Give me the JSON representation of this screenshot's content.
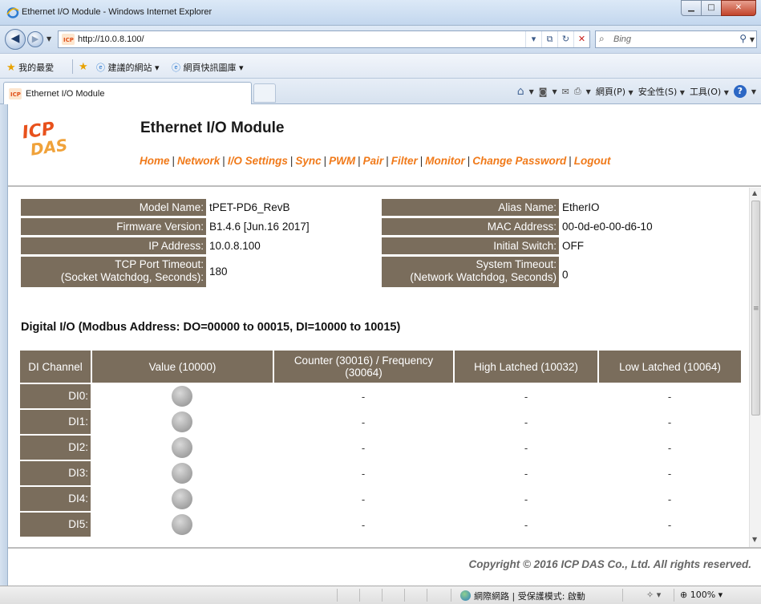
{
  "window": {
    "title": "Ethernet I/O Module - Windows Internet Explorer",
    "min_glyph": "▁",
    "max_glyph": "□",
    "close_glyph": "✕"
  },
  "address_bar": {
    "url": "http://10.0.8.100/",
    "search_placeholder": "Bing"
  },
  "favorites_bar": {
    "favorites_label": "我的最愛",
    "suggested_sites": "建議的網站 ▾",
    "web_slice_gallery": "網頁快訊圖庫 ▾"
  },
  "tab": {
    "label": "Ethernet I/O Module"
  },
  "command_bar": {
    "page": "網頁(P)",
    "safety": "安全性(S)",
    "tools": "工具(O)",
    "help": "?"
  },
  "header": {
    "logo_text": "ICP DAS",
    "title": "Ethernet I/O Module",
    "nav": [
      "Home",
      "Network",
      "I/O Settings",
      "Sync",
      "PWM",
      "Pair",
      "Filter",
      "Monitor",
      "Change Password",
      "Logout"
    ]
  },
  "info": {
    "left": [
      {
        "label": "Model Name:",
        "value": "tPET-PD6_RevB"
      },
      {
        "label": "Firmware Version:",
        "value": "B1.4.6 [Jun.16 2017]"
      },
      {
        "label": "IP Address:",
        "value": "10.0.8.100"
      },
      {
        "label_line1": "TCP Port Timeout:",
        "label_line2": "(Socket Watchdog, Seconds):",
        "value": "180"
      }
    ],
    "right": [
      {
        "label": "Alias Name:",
        "value": "EtherIO"
      },
      {
        "label": "MAC Address:",
        "value": "00-0d-e0-00-d6-10"
      },
      {
        "label": "Initial Switch:",
        "value": "OFF"
      },
      {
        "label_line1": "System Timeout:",
        "label_line2": "(Network Watchdog, Seconds)",
        "value": "0"
      }
    ]
  },
  "digital_io": {
    "section_title": "Digital I/O (Modbus Address: DO=00000 to 00015, DI=10000 to 10015)",
    "columns": {
      "channel": "DI Channel",
      "value": "Value (10000)",
      "counter_line1": "Counter (30016) / Frequency",
      "counter_line2": "(30064)",
      "high": "High Latched (10032)",
      "low": "Low Latched (10064)"
    },
    "rows": [
      {
        "channel": "DI0:",
        "state": "off",
        "counter": "-",
        "high": "-",
        "low": "-"
      },
      {
        "channel": "DI1:",
        "state": "off",
        "counter": "-",
        "high": "-",
        "low": "-"
      },
      {
        "channel": "DI2:",
        "state": "off",
        "counter": "-",
        "high": "-",
        "low": "-"
      },
      {
        "channel": "DI3:",
        "state": "off",
        "counter": "-",
        "high": "-",
        "low": "-"
      },
      {
        "channel": "DI4:",
        "state": "off",
        "counter": "-",
        "high": "-",
        "low": "-"
      },
      {
        "channel": "DI5:",
        "state": "off",
        "counter": "-",
        "high": "-",
        "low": "-"
      }
    ]
  },
  "footer": {
    "copyright": "Copyright © 2016 ICP DAS Co., Ltd. All rights reserved."
  },
  "status_bar": {
    "zone": "網際網路 | 受保護模式: 啟動",
    "zoom": "100%"
  },
  "colors": {
    "label_bg": "#7a6d5c",
    "nav_link": "#f07a1a",
    "led_off": "#a2a2a2"
  }
}
